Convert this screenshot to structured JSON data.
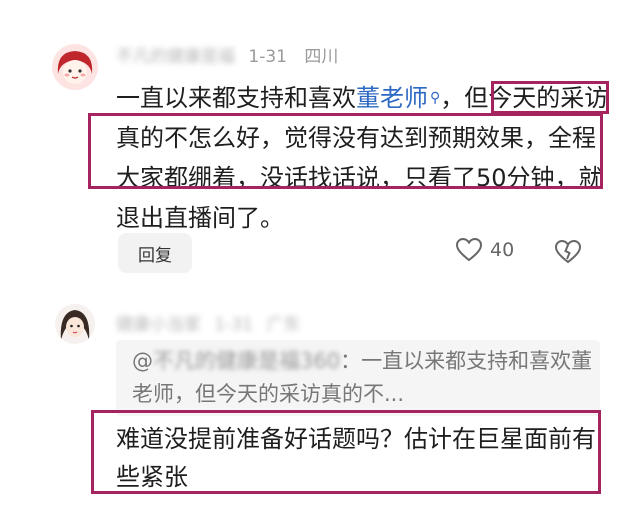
{
  "comment1": {
    "username": "不凡的健康是福",
    "date": "1-31",
    "location": "四川",
    "text_part1": "一直以来都支持和喜欢",
    "mention": "董老师",
    "text_part2": "，但今天的采访真的不怎么好，觉得没有达到预期效果，全程大家都绷着，没话找话说，只看了50分钟，就退出直播间了。",
    "reply_label": "回复",
    "like_count": "40"
  },
  "comment2": {
    "username": "健康小当家",
    "date": "1-31",
    "location": "广东",
    "quote_prefix": "@",
    "quote_user": "不凡的健康是福360",
    "quote_text": "：一直以来都支持和喜欢董老师，但今天的采访真的不...",
    "text": "难道没提前准备好话题吗？估计在巨星面前有些紧张"
  },
  "colors": {
    "highlight": "#a5245f",
    "mention": "#2d68c4"
  }
}
